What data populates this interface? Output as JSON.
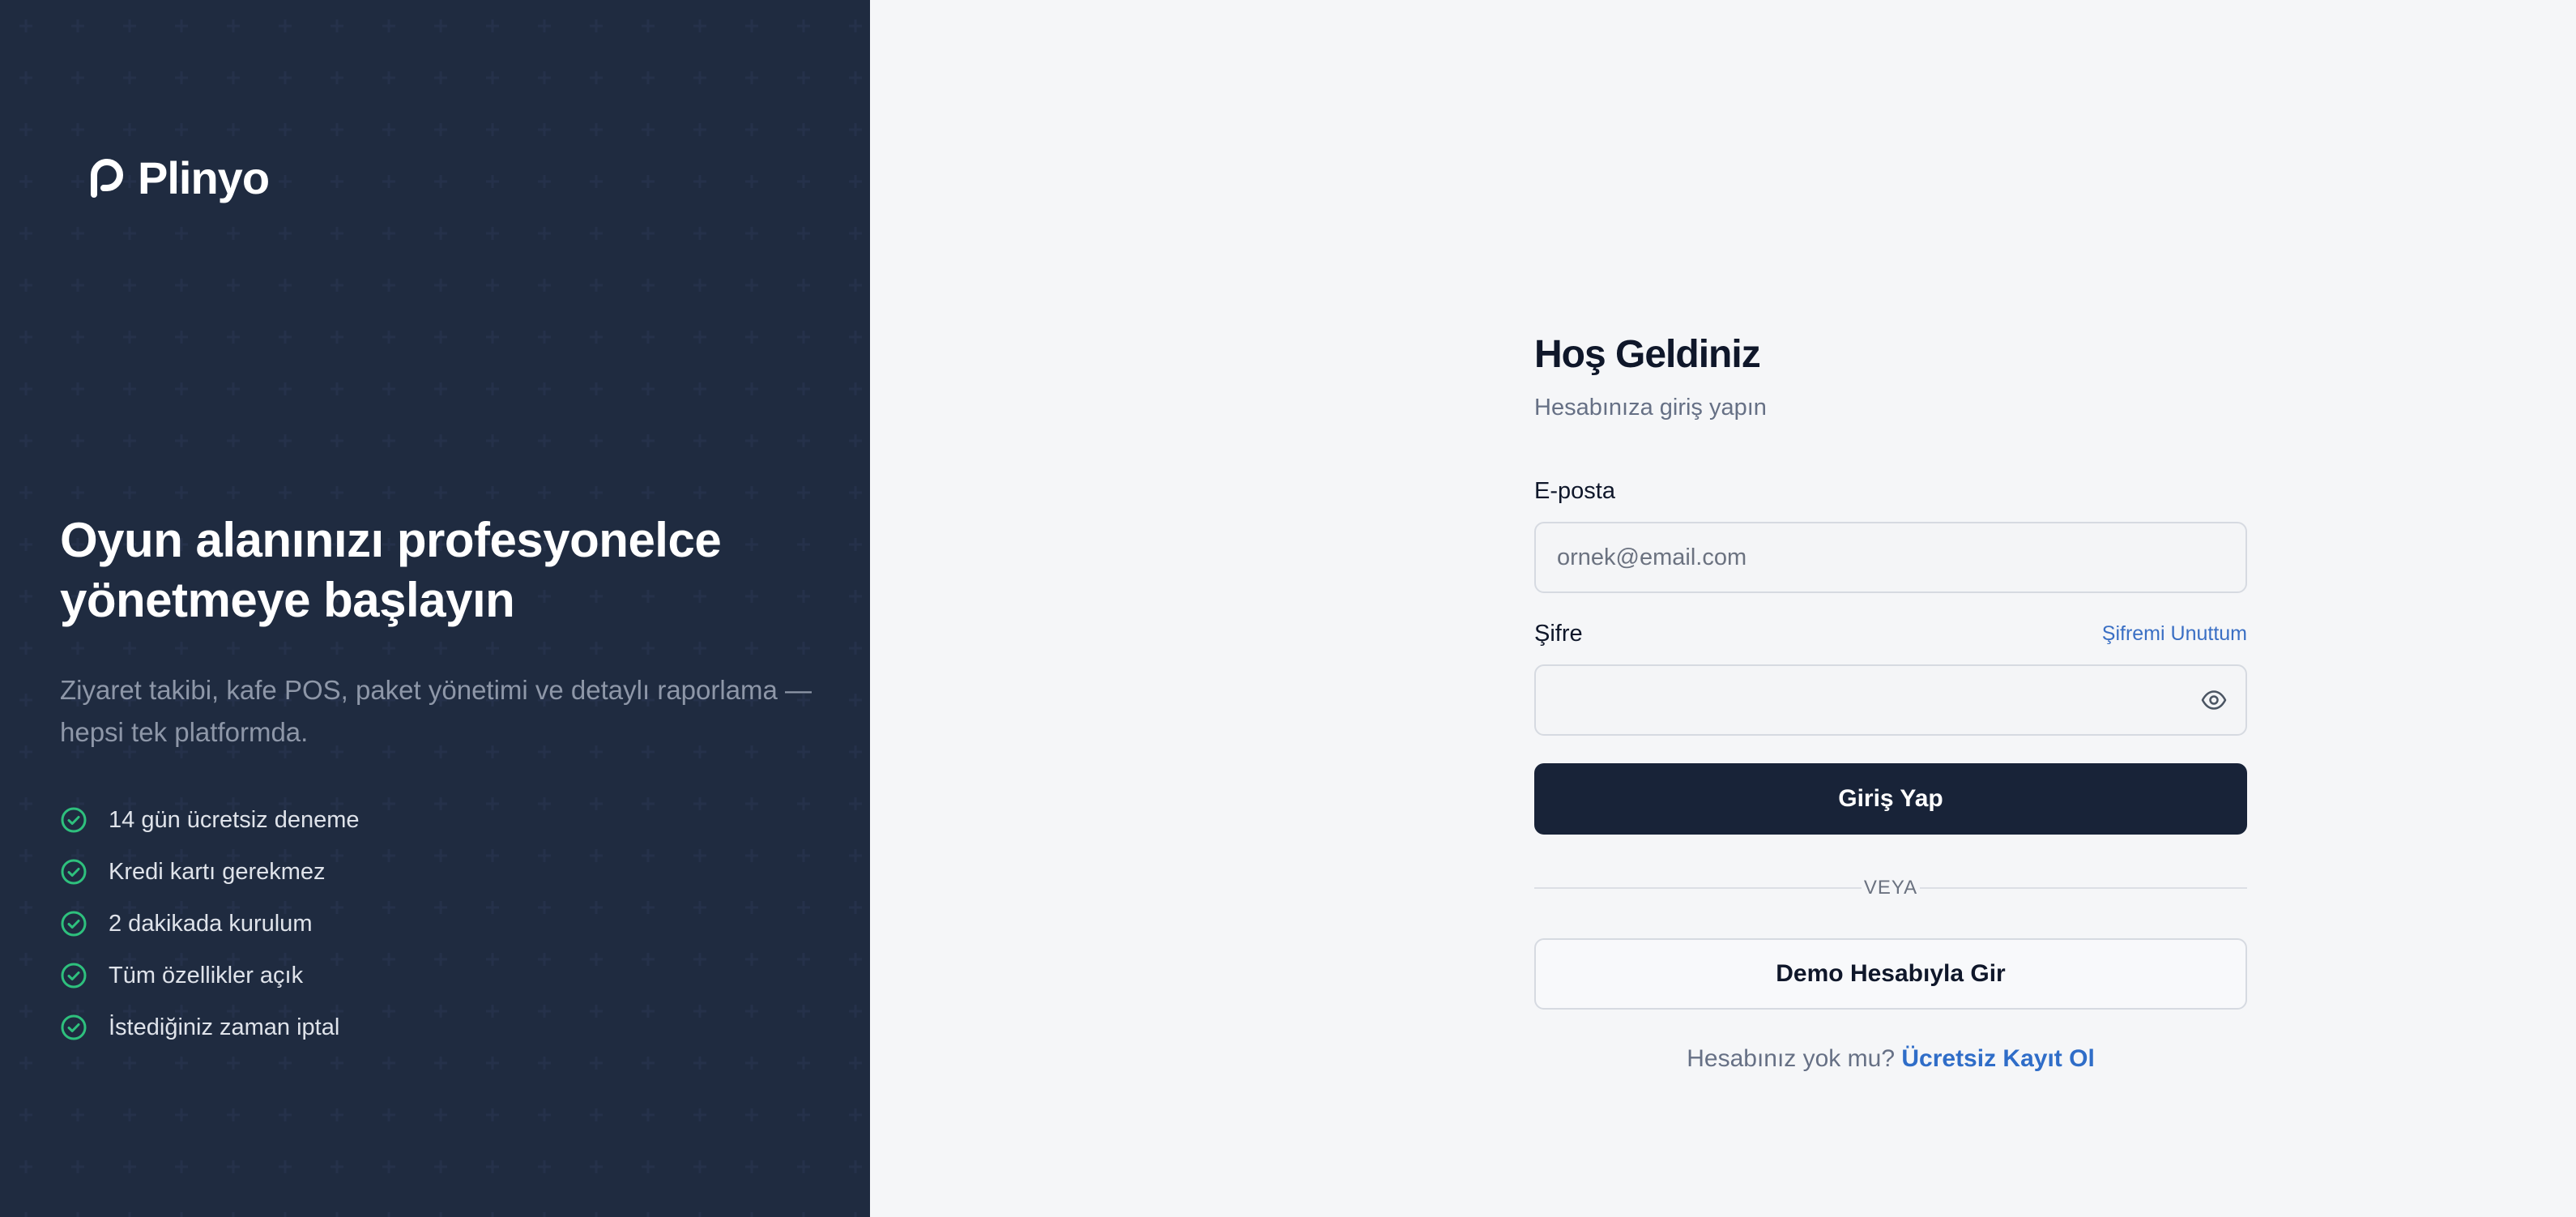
{
  "brand": {
    "name": "Plinyo",
    "logo_icon": "plinyo-p-logo-icon"
  },
  "hero": {
    "title": "Oyun alanınızı profesyonelce yönetmeye başlayın",
    "subtitle": "Ziyaret takibi, kafe POS, paket yönetimi ve detaylı raporlama — hepsi tek platformda."
  },
  "features": [
    "14 gün ücretsiz deneme",
    "Kredi kartı gerekmez",
    "2 dakikada kurulum",
    "Tüm özellikler açık",
    "İstediğiniz zaman iptal"
  ],
  "form": {
    "title": "Hoş Geldiniz",
    "subtitle": "Hesabınıza giriş yapın",
    "email_label": "E-posta",
    "email_placeholder": "ornek@email.com",
    "email_value": "",
    "password_label": "Şifre",
    "password_mask": "••••••••",
    "forgot_label": "Şifremi Unuttum",
    "submit_label": "Giriş Yap",
    "divider_label": "VEYA",
    "demo_label": "Demo Hesabıyla Gir",
    "signup_prompt": "Hesabınız yok mu?",
    "signup_link": "Ücretsiz Kayıt Ol"
  },
  "colors": {
    "panel_bg": "#182338",
    "page_bg": "#f5f6f8",
    "accent_link": "#2f6dc8",
    "check_green": "#2ec07d"
  },
  "icons": {
    "feature_check": "check-circle-icon",
    "password_toggle": "eye-icon"
  }
}
